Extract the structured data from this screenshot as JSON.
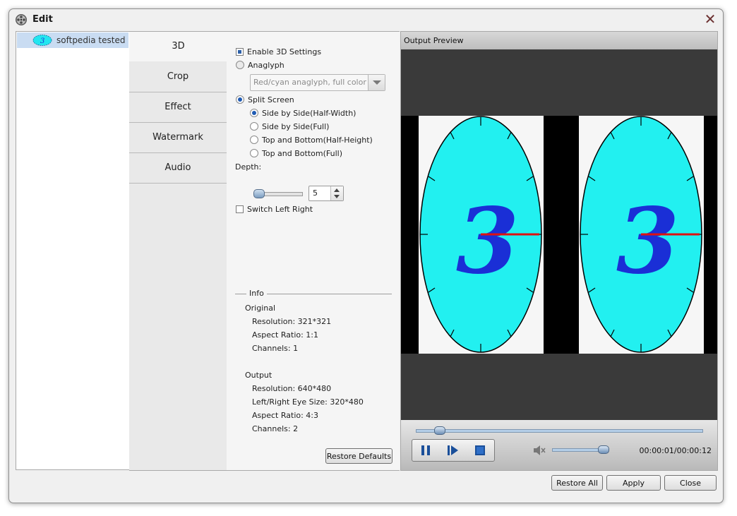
{
  "window": {
    "title": "Edit"
  },
  "file_list": {
    "items": [
      {
        "label": "softpedia tested"
      }
    ]
  },
  "tabs": [
    {
      "label": "3D"
    },
    {
      "label": "Crop"
    },
    {
      "label": "Effect"
    },
    {
      "label": "Watermark"
    },
    {
      "label": "Audio"
    }
  ],
  "settings3d": {
    "enable_label": "Enable 3D Settings",
    "enable_checked": true,
    "anaglyph_label": "Anaglyph",
    "anaglyph_combo_value": "Red/cyan anaglyph, full color",
    "split_label": "Split Screen",
    "split_options": [
      {
        "label": "Side by Side(Half-Width)",
        "selected": true
      },
      {
        "label": "Side by Side(Full)",
        "selected": false
      },
      {
        "label": "Top and Bottom(Half-Height)",
        "selected": false
      },
      {
        "label": "Top and Bottom(Full)",
        "selected": false
      }
    ],
    "depth_label": "Depth:",
    "depth_value": "5",
    "switch_label": "Switch Left Right",
    "switch_checked": false
  },
  "info": {
    "title": "Info",
    "original_heading": "Original",
    "original": [
      "Resolution: 321*321",
      "Aspect Ratio: 1:1",
      "Channels: 1"
    ],
    "output_heading": "Output",
    "output": [
      "Resolution: 640*480",
      "Left/Right Eye Size: 320*480",
      "Aspect Ratio: 4:3",
      "Channels: 2"
    ],
    "restore_defaults": "Restore Defaults"
  },
  "preview": {
    "label": "Output Preview",
    "time": "00:00:01/00:00:12",
    "seek_fraction": 0.08,
    "volume_fraction": 0.92,
    "frame_digit": "3"
  },
  "footer": {
    "restore_all": "Restore All",
    "apply": "Apply",
    "close": "Close"
  },
  "colors": {
    "dial": "#22f0f0",
    "digit": "#1a2fd6",
    "hand": "#dd1111"
  }
}
